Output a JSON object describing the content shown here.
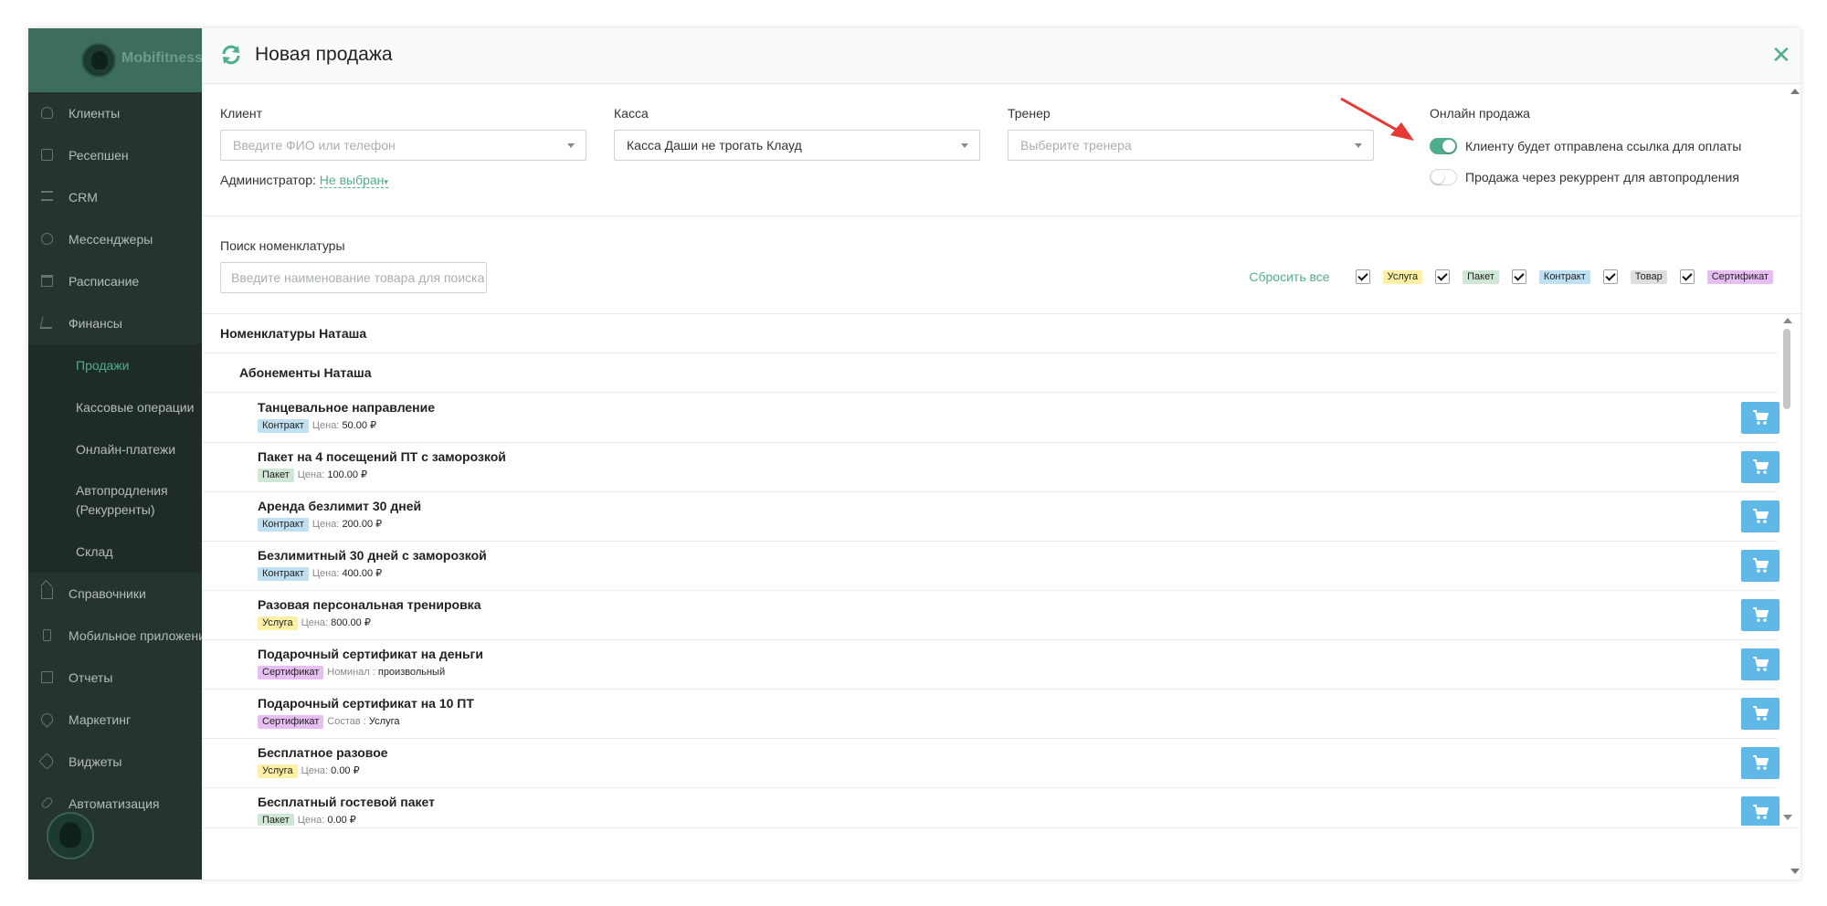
{
  "sidebar": {
    "logo_text": "Mobifitness",
    "items": [
      {
        "label": "Клиенты",
        "icon": "person-icon"
      },
      {
        "label": "Ресепшен",
        "icon": "clipboard-icon"
      },
      {
        "label": "CRM",
        "icon": "list-icon"
      },
      {
        "label": "Мессенджеры",
        "icon": "chat-icon"
      },
      {
        "label": "Расписание",
        "icon": "calendar-icon"
      },
      {
        "label": "Финансы",
        "icon": "cart-icon"
      }
    ],
    "finance_sub": [
      {
        "label": "Продажи",
        "active": true
      },
      {
        "label": "Кассовые операции"
      },
      {
        "label": "Онлайн-платежи"
      },
      {
        "label": "Автопродления (Рекурренты)"
      },
      {
        "label": "Склад"
      }
    ],
    "items_after": [
      {
        "label": "Справочники",
        "icon": "home-icon"
      },
      {
        "label": "Мобильное приложение",
        "icon": "phone-icon"
      },
      {
        "label": "Отчеты",
        "icon": "report-icon"
      },
      {
        "label": "Маркетинг",
        "icon": "pin-icon"
      },
      {
        "label": "Виджеты",
        "icon": "tag-icon"
      },
      {
        "label": "Автоматизация",
        "icon": "link-icon"
      }
    ]
  },
  "modal": {
    "title": "Новая продажа",
    "close_icon": "close-icon",
    "client": {
      "label": "Клиент",
      "placeholder": "Введите ФИО или телефон"
    },
    "admin": {
      "label": "Администратор:",
      "value": "Не выбран"
    },
    "kassa": {
      "label": "Касса",
      "value": "Касса Даши не трогать Клауд"
    },
    "trainer": {
      "label": "Тренер",
      "placeholder": "Выберите тренера"
    },
    "online": {
      "label": "Онлайн продажа",
      "toggle1": {
        "label": "Клиенту будет отправлена ссылка для оплаты",
        "on": true
      },
      "toggle2": {
        "label": "Продажа через рекуррент для автопродления",
        "on": false
      }
    },
    "search": {
      "label": "Поиск номенклатуры",
      "placeholder": "Введите наименование товара для поиска"
    },
    "filters": {
      "reset": "Сбросить все",
      "items": [
        "Услуга",
        "Пакет",
        "Контракт",
        "Товар",
        "Сертификат"
      ]
    },
    "groups": {
      "group1": "Номенклатуры Наташа",
      "group2": "Абонементы Наташа"
    },
    "items": [
      {
        "title": "Танцевальное направление",
        "badge": "Контракт",
        "meta_label": "Цена:",
        "meta_value": "50.00 ₽"
      },
      {
        "title": "Пакет на 4 посещений ПТ с заморозкой",
        "badge": "Пакет",
        "meta_label": "Цена:",
        "meta_value": "100.00 ₽"
      },
      {
        "title": "Аренда безлимит 30 дней",
        "badge": "Контракт",
        "meta_label": "Цена:",
        "meta_value": "200.00 ₽"
      },
      {
        "title": "Безлимитный 30 дней с заморозкой",
        "badge": "Контракт",
        "meta_label": "Цена:",
        "meta_value": "400.00 ₽"
      },
      {
        "title": "Разовая персональная тренировка",
        "badge": "Услуга",
        "meta_label": "Цена:",
        "meta_value": "800.00 ₽"
      },
      {
        "title": "Подарочный сертификат на деньги",
        "badge": "Сертификат",
        "meta_label": "Номинал :",
        "meta_value": "произвольный"
      },
      {
        "title": "Подарочный сертификат на 10 ПТ",
        "badge": "Сертификат",
        "meta_label": "Состав :",
        "meta_value": "Услуга"
      },
      {
        "title": "Бесплатное разовое",
        "badge": "Услуга",
        "meta_label": "Цена:",
        "meta_value": "0.00 ₽"
      },
      {
        "title": "Бесплатный гостевой пакет",
        "badge": "Пакет",
        "meta_label": "Цена:",
        "meta_value": "0.00 ₽"
      }
    ]
  },
  "colors": {
    "accent": "#4fae8c",
    "cart_button": "#5fb8e5",
    "sidebar_bg": "#263430",
    "annotation_arrow": "#e53935"
  }
}
